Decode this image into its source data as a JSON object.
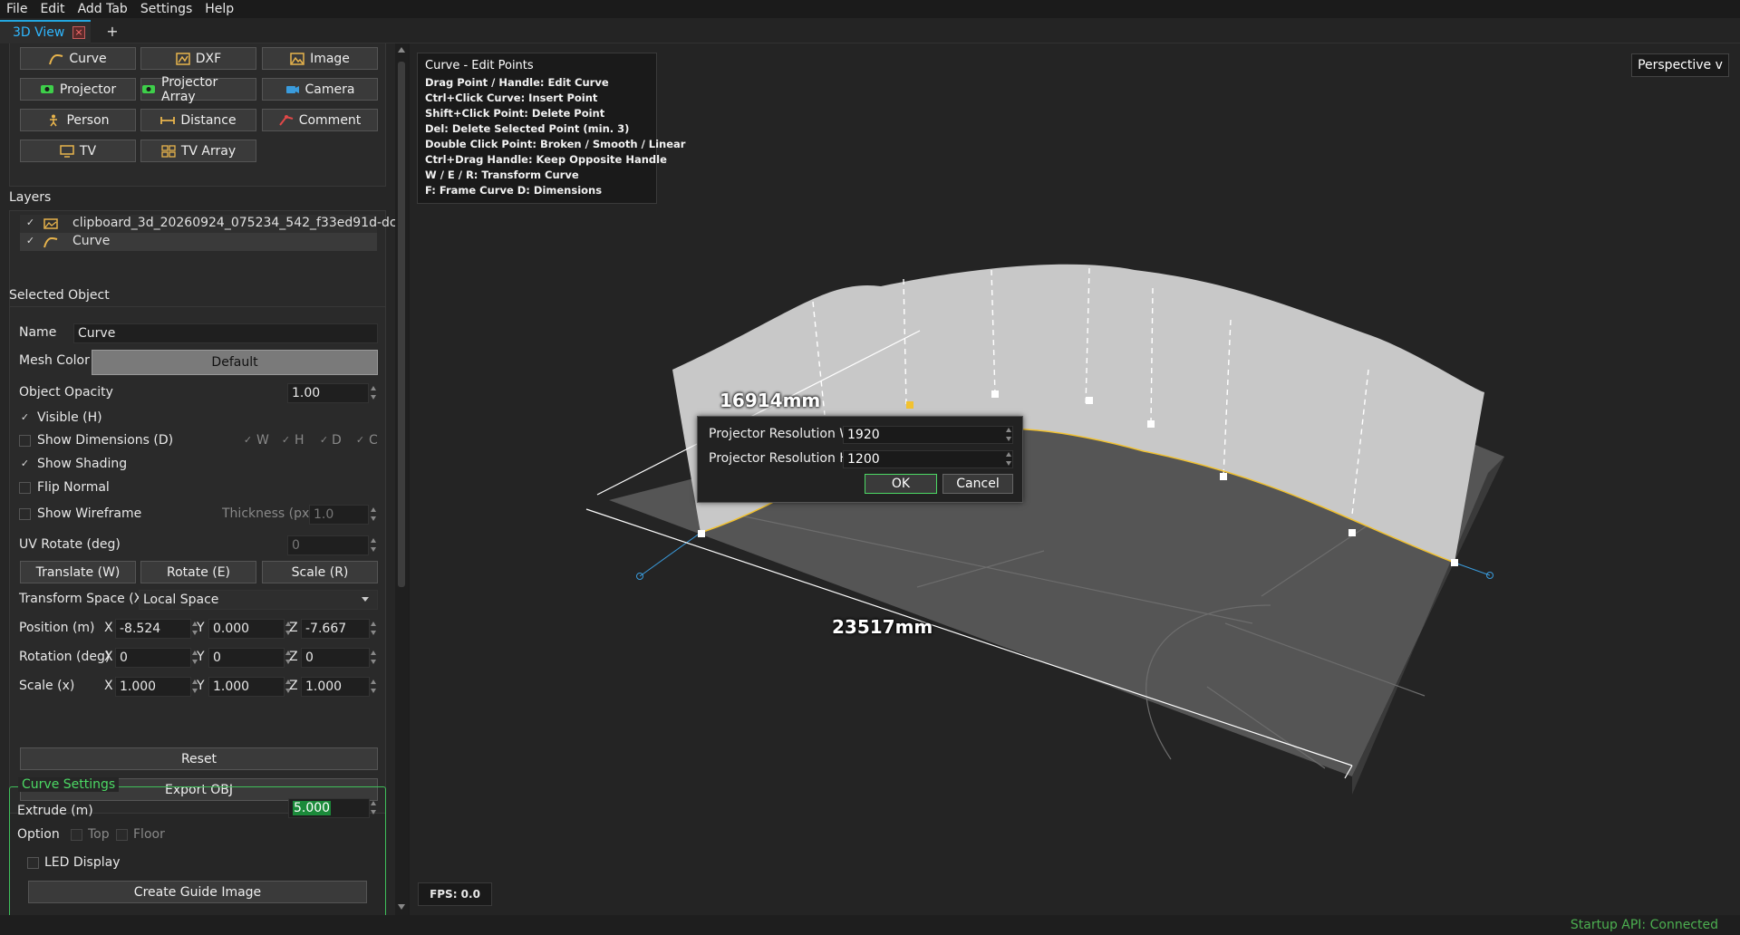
{
  "menu": [
    "File",
    "Edit",
    "Add Tab",
    "Settings",
    "Help"
  ],
  "tabs": {
    "active": "3D View",
    "close": "×",
    "add": "+"
  },
  "toolbar": {
    "curve": "Curve",
    "dxf": "DXF",
    "image": "Image",
    "projector": "Projector",
    "projector_array": "Projector Array",
    "camera": "Camera",
    "person": "Person",
    "distance": "Distance",
    "comment": "Comment",
    "tv": "TV",
    "tv_array": "TV Array"
  },
  "layers": {
    "title": "Layers",
    "items": [
      {
        "name": "clipboard_3d_20260924_075234_542_f33ed91d-dc…",
        "checked": "✓"
      },
      {
        "name": "Curve",
        "checked": "✓"
      }
    ]
  },
  "selected": {
    "title": "Selected Object",
    "name_label": "Name",
    "name_value": "Curve",
    "mesh_color_label": "Mesh Color",
    "mesh_color_value": "Default",
    "opacity_label": "Object Opacity",
    "opacity_value": "1.00",
    "visible_label": "Visible (H)",
    "show_dims_label": "Show Dimensions (D)",
    "dim_w": "W",
    "dim_h": "H",
    "dim_d": "D",
    "dim_c": "C",
    "shading_label": "Show Shading",
    "flip_label": "Flip Normal",
    "wireframe_label": "Show Wireframe",
    "thickness_label": "Thickness (px)",
    "thickness_value": "1.0",
    "uv_label": "UV Rotate (deg)",
    "uv_value": "0",
    "translate_btn": "Translate (W)",
    "rotate_btn": "Rotate (E)",
    "scale_btn": "Scale (R)",
    "space_label": "Transform Space (X)",
    "space_value": "Local Space",
    "position_label": "Position (m)",
    "pos_x": "-8.524",
    "pos_y": "0.000",
    "pos_z": "-7.667",
    "rotation_label": "Rotation (deg)",
    "rot_x": "0",
    "rot_y": "0",
    "rot_z": "0",
    "scale_label": "Scale (x)",
    "sc_x": "1.000",
    "sc_y": "1.000",
    "sc_z": "1.000",
    "axis_x": "X",
    "axis_y": "Y",
    "axis_z": "Z",
    "reset_btn": "Reset",
    "export_btn": "Export OBJ"
  },
  "curve_settings": {
    "title": "Curve Settings",
    "extrude_label": "Extrude (m)",
    "extrude_value": "5.000",
    "option_label": "Option",
    "top_label": "Top",
    "floor_label": "Floor",
    "led_label": "LED Display",
    "guide_btn": "Create Guide Image"
  },
  "viewport": {
    "help_title": "Curve - Edit Points",
    "help_lines": [
      "Drag Point / Handle: Edit Curve",
      "Ctrl+Click Curve: Insert Point",
      "Shift+Click Point: Delete Point",
      "Del: Delete Selected Point (min. 3)",
      "Double Click Point: Broken / Smooth / Linear",
      "Ctrl+Drag Handle: Keep Opposite Handle",
      "W / E / R: Transform Curve",
      "F: Frame Curve   D: Dimensions"
    ],
    "perspective": "Perspective v",
    "dim1": "16914mm",
    "dim2": "23517mm",
    "fps": "FPS: 0.0"
  },
  "dialog": {
    "res_w_label": "Projector Resolution W",
    "res_w": "1920",
    "res_h_label": "Projector Resolution H",
    "res_h": "1200",
    "ok": "OK",
    "cancel": "Cancel"
  },
  "status": "Startup API: Connected",
  "colors": {
    "accent": "#2fb7ff",
    "green": "#4caf50",
    "highlight": "#1b8a3a"
  }
}
